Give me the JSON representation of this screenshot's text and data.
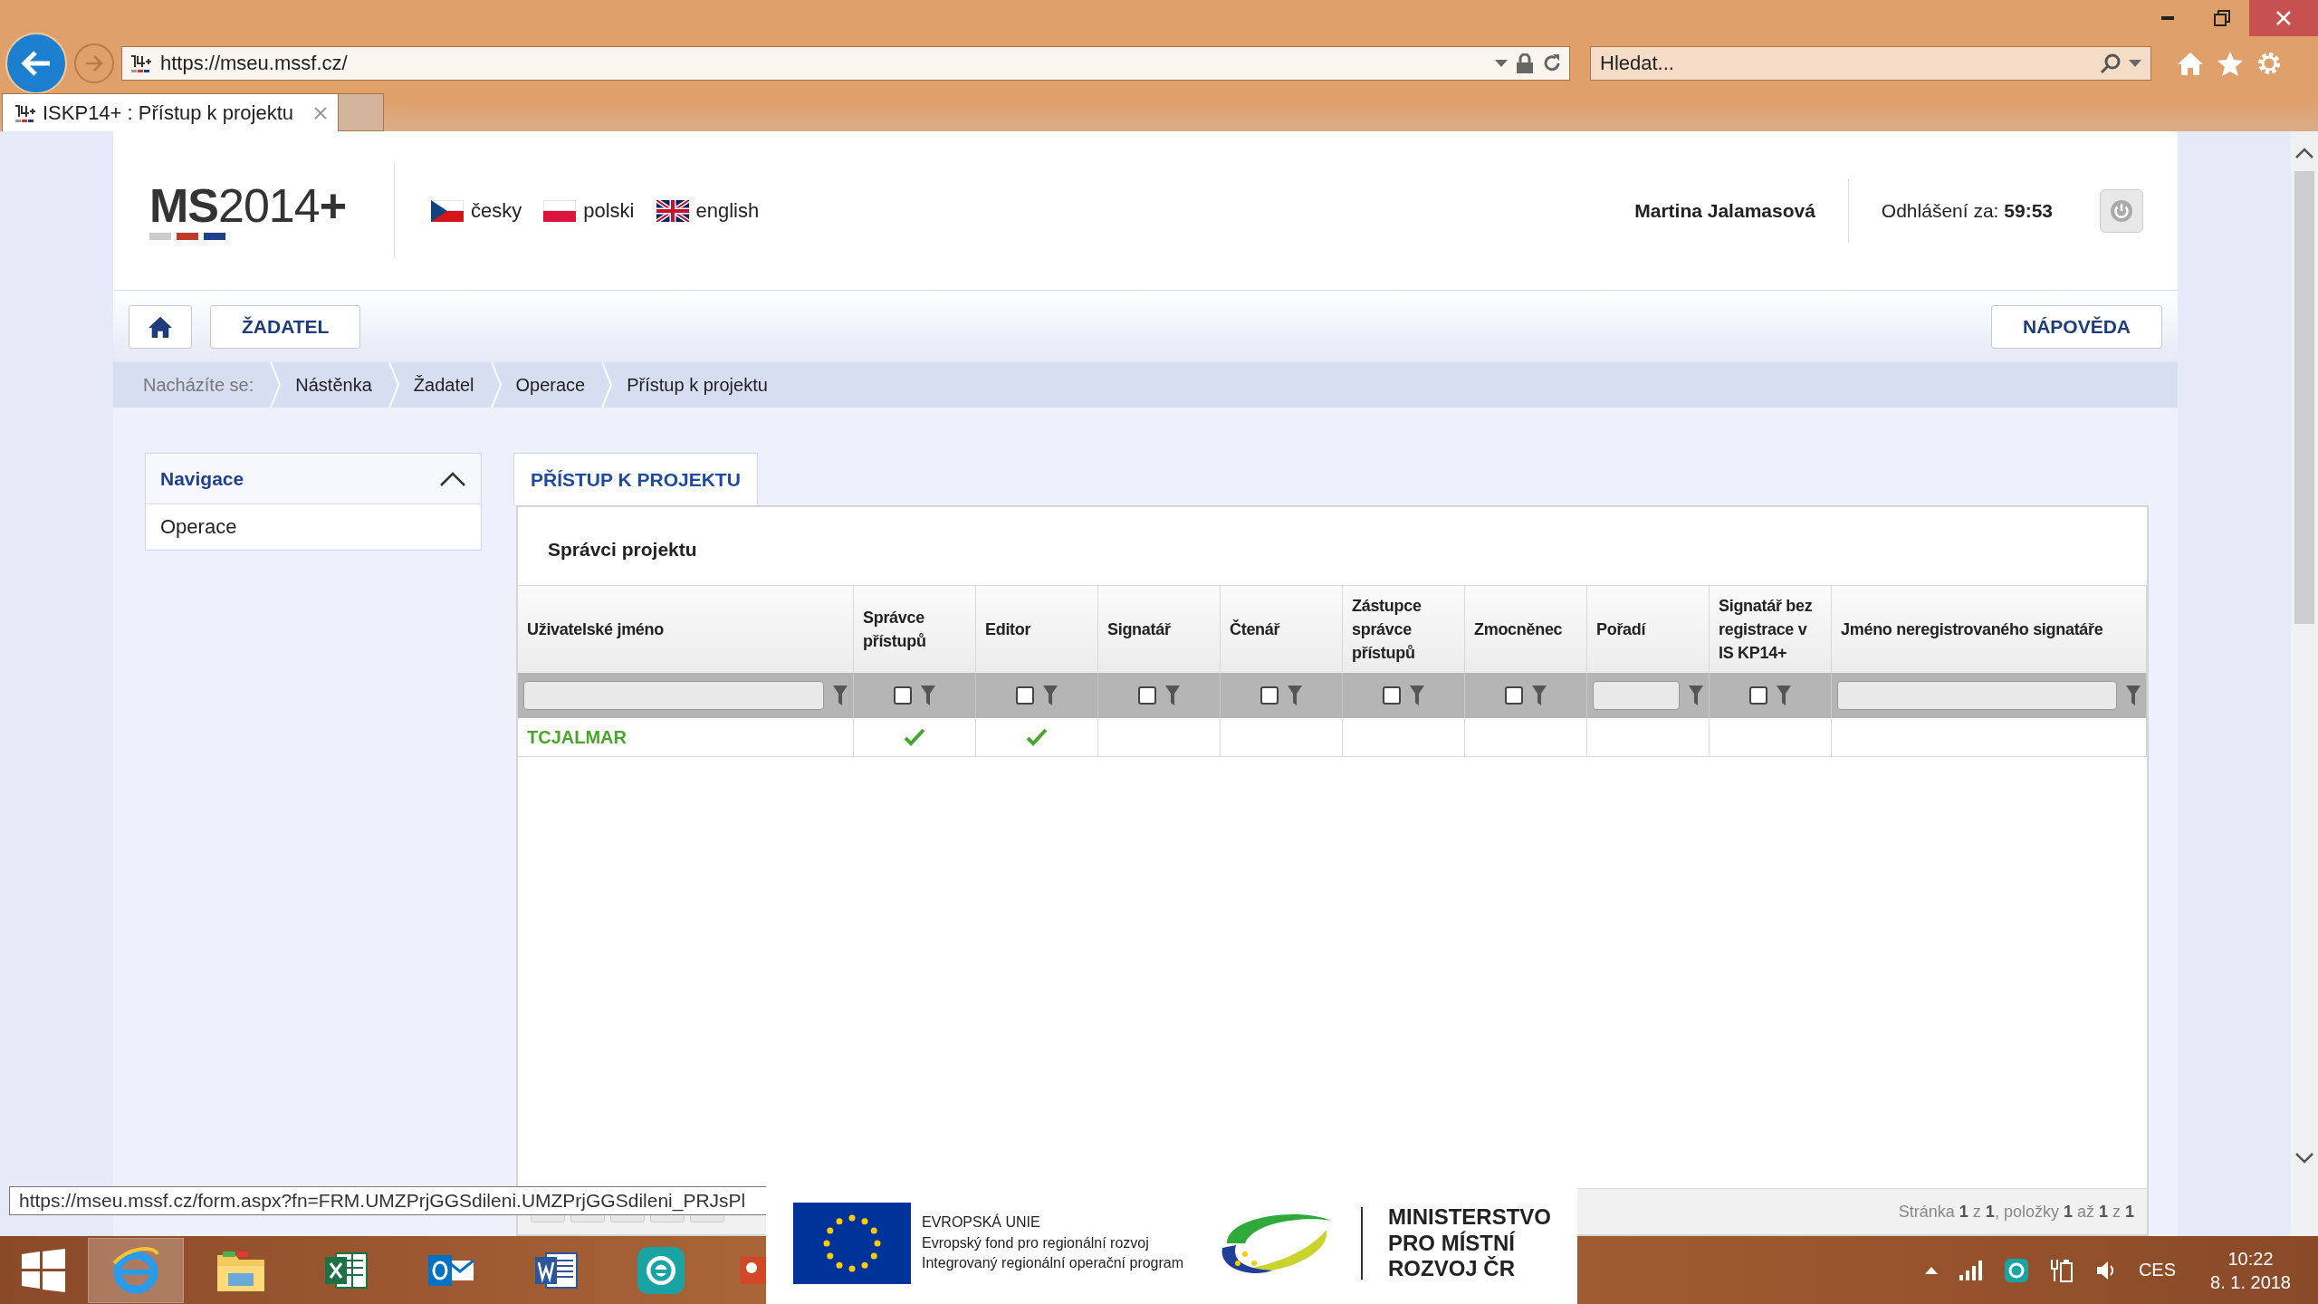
{
  "browser": {
    "address": "https://mseu.mssf.cz/",
    "search_placeholder": "Hledat...",
    "tabs": [
      {
        "title": "ISKP14+ : Přístup k projektu",
        "selected": true
      }
    ]
  },
  "header": {
    "logo": "**MS**2014**+**",
    "languages": [
      {
        "label": "česky",
        "kind": "cz"
      },
      {
        "label": "polski",
        "kind": "pl"
      },
      {
        "label": "english",
        "kind": "uk"
      }
    ],
    "user": "Martina Jalamasová",
    "logout": "Odhlášení za: **59:53**"
  },
  "nav": {
    "items": [
      "ŽADATEL"
    ],
    "help": "NÁPOVĚDA"
  },
  "breadcrumb": {
    "label": "Nacházíte se:",
    "items": [
      "Nástěnka",
      "Žadatel",
      "Operace",
      "Přístup k projektu"
    ]
  },
  "sidebar": {
    "title": "Navigace",
    "expanded": true,
    "items": [
      "Operace"
    ]
  },
  "tab": {
    "label": "PŘÍSTUP K PROJEKTU",
    "selected": true
  },
  "section_title": "Správci projektu",
  "table": {
    "columns": [
      {
        "label": "Uživatelské jméno",
        "kind": "text"
      },
      {
        "label": "Správce přístupů",
        "kind": "checkbox",
        "checked": false
      },
      {
        "label": "Editor",
        "kind": "checkbox",
        "checked": false
      },
      {
        "label": "Signatář",
        "kind": "checkbox",
        "checked": false
      },
      {
        "label": "Čtenář",
        "kind": "checkbox",
        "checked": false
      },
      {
        "label": "Zástupce správce přístupů",
        "kind": "checkbox",
        "checked": false
      },
      {
        "label": "Zmocněnec",
        "kind": "checkbox",
        "checked": false
      },
      {
        "label": "Pořadí",
        "kind": "text"
      },
      {
        "label": "Signatář bez registrace v IS KP14+",
        "kind": "checkbox",
        "checked": false
      },
      {
        "label": "Jméno neregistrovaného signatáře",
        "kind": "text"
      }
    ],
    "rows": [
      {
        "cells": [
          {
            "kind": "link",
            "value": "TCJALMAR"
          },
          {
            "kind": "check",
            "checked": true
          },
          {
            "kind": "check",
            "checked": true
          },
          {
            "kind": "check",
            "checked": false
          },
          {
            "kind": "check",
            "checked": false
          },
          {
            "kind": "check",
            "checked": false
          },
          {
            "kind": "check",
            "checked": false
          },
          {
            "kind": "blank"
          },
          {
            "kind": "check",
            "checked": false
          },
          {
            "kind": "blank"
          }
        ]
      }
    ]
  },
  "pagination": "Stránka **1** z **1**, položky **1** až **1** z **1**",
  "status_url": "https://mseu.mssf.cz/form.aspx?fn=FRM.UMZPrjGGSdileni.UMZPrjGGSdileni_PRJsPl",
  "banner": {
    "eu_title": "EVROPSKÁ UNIE",
    "eu_lines": [
      "Evropský fond pro regionální rozvoj",
      "Integrovaný regionální operační program"
    ],
    "ministry": [
      "MINISTERSTVO",
      "PRO MÍSTNÍ",
      "ROZVOJ ČR"
    ]
  },
  "taskbar": {
    "apps": [
      {
        "kind": "browser",
        "selected": true
      },
      {
        "kind": "folder",
        "selected": false
      },
      {
        "kind": "sheet",
        "selected": false
      },
      {
        "kind": "mail",
        "selected": false
      },
      {
        "kind": "doc",
        "selected": false
      },
      {
        "kind": "shield",
        "selected": false
      },
      {
        "kind": "slides",
        "selected": false
      }
    ],
    "language": "CES",
    "time": "10:22",
    "date": "8. 1. 2018"
  }
}
